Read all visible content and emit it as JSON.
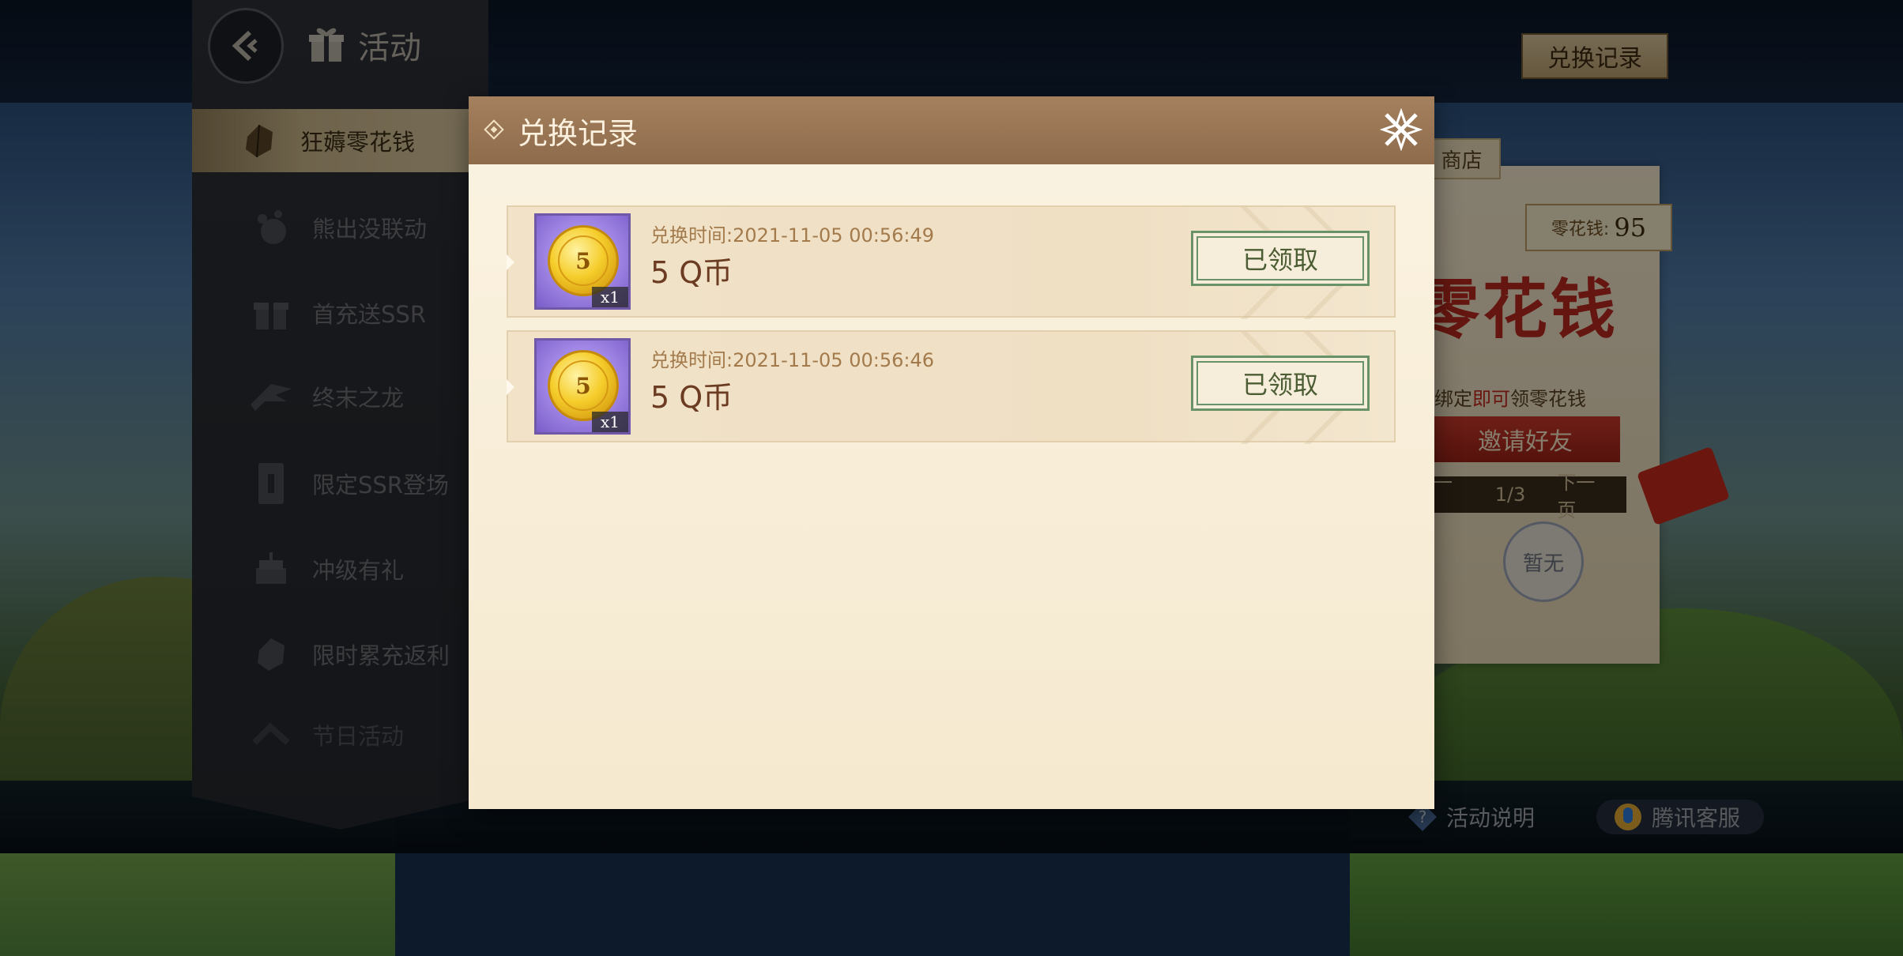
{
  "header": {
    "title": "活动",
    "record_button": "兑换记录"
  },
  "sidebar": {
    "items": [
      {
        "label": "狂薅零花钱",
        "icon": "gem-icon",
        "active": true
      },
      {
        "label": "熊出没联动",
        "icon": "bear-icon"
      },
      {
        "label": "首充送SSR",
        "icon": "gift-icon"
      },
      {
        "label": "终末之龙",
        "icon": "dragon-icon"
      },
      {
        "label": "限定SSR登场",
        "icon": "card-icon"
      },
      {
        "label": "冲级有礼",
        "icon": "cake-icon"
      },
      {
        "label": "限时累充返利",
        "icon": "gem-icon"
      },
      {
        "label": "节日活动",
        "icon": "ribbon-icon"
      }
    ]
  },
  "background_panel": {
    "shop_tab": "商店",
    "coin_label": "零花钱:",
    "coin_value": "95",
    "big_title": "零花钱",
    "bind_prefix": "绑定",
    "bind_highlight": "即可",
    "bind_suffix": "领零花钱",
    "invite_button": "邀请好友",
    "pager": {
      "prev": "上一页",
      "page": "1/3",
      "next": "下一页"
    },
    "none_badge": "暂无"
  },
  "bottom": {
    "help": "活动说明",
    "service": "腾讯客服"
  },
  "modal": {
    "title": "兑换记录",
    "records": [
      {
        "time_label": "兑换时间:",
        "time": "2021-11-05 00:56:49",
        "name": "5 Q币",
        "coin_value": "5",
        "qty": "x1",
        "status": "已领取"
      },
      {
        "time_label": "兑换时间:",
        "time": "2021-11-05 00:56:46",
        "name": "5 Q币",
        "coin_value": "5",
        "qty": "x1",
        "status": "已领取"
      }
    ]
  },
  "colors": {
    "modal_header": "#9a7656",
    "modal_body": "#f8eed8",
    "claimed_border": "#6a9269",
    "accent_red": "#b8281e"
  }
}
